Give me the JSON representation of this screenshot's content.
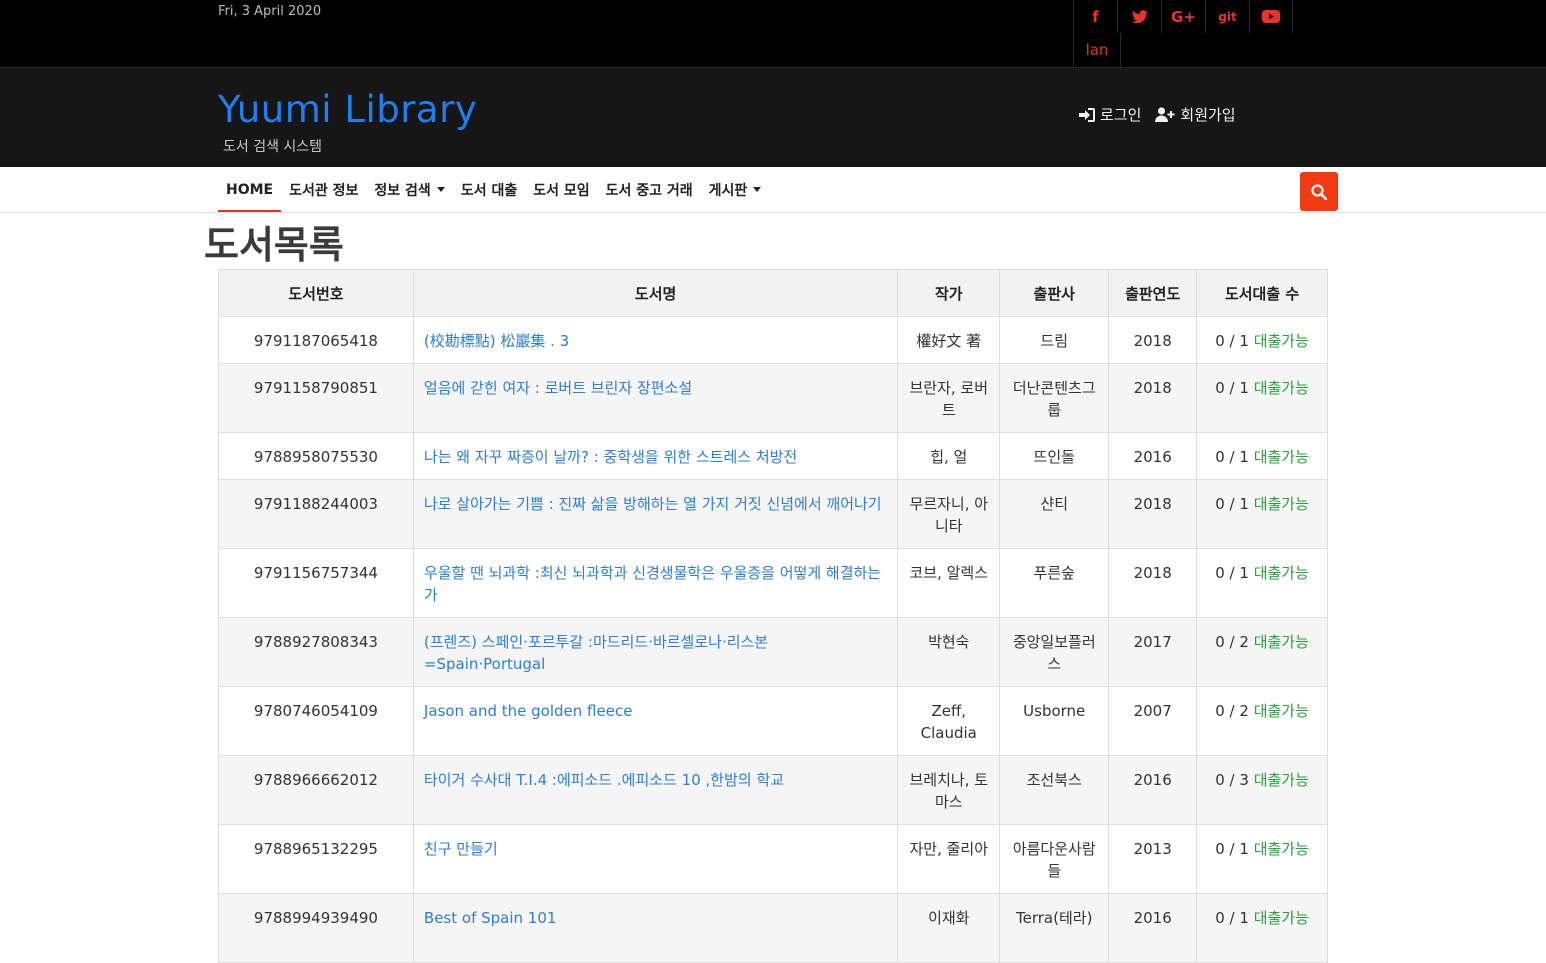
{
  "topbar": {
    "date": "Fri, 3 April 2020",
    "social": [
      {
        "icon": "facebook-icon",
        "glyph": "f"
      },
      {
        "icon": "twitter-icon",
        "glyph": "🐦"
      },
      {
        "icon": "google-plus-icon",
        "glyph": "G+"
      },
      {
        "icon": "git-icon",
        "glyph": "git"
      },
      {
        "icon": "youtube-icon",
        "glyph": "▶"
      }
    ],
    "lan": "lan"
  },
  "brand": {
    "title": "Yuumi Library",
    "subtitle": "도서 검색 시스템"
  },
  "auth": {
    "login": "로그인",
    "signup": "회원가입"
  },
  "nav": [
    {
      "label": "HOME",
      "dropdown": false
    },
    {
      "label": "도서관 정보",
      "dropdown": false
    },
    {
      "label": "정보 검색",
      "dropdown": true
    },
    {
      "label": "도서 대출",
      "dropdown": false
    },
    {
      "label": "도서 모임",
      "dropdown": false
    },
    {
      "label": "도서 중고 거래",
      "dropdown": false
    },
    {
      "label": "게시판",
      "dropdown": true
    }
  ],
  "page_title": "도서목록",
  "table": {
    "headers": [
      "도서번호",
      "도서명",
      "작가",
      "출판사",
      "출판연도",
      "도서대출 수"
    ],
    "rows": [
      {
        "isbn": "9791187065418",
        "title": "(校勘標點) 松巖集 . 3",
        "author": "權好文 著",
        "publisher": "드림",
        "year": "2018",
        "count": "0 / 1",
        "status": "대출가능"
      },
      {
        "isbn": "9791158790851",
        "title": "얼음에 갇힌 여자 : 로버트 브린자 장편소설",
        "author": "브란자, 로버트",
        "publisher": "더난콘텐츠그룹",
        "year": "2018",
        "count": "0 / 1",
        "status": "대출가능"
      },
      {
        "isbn": "9788958075530",
        "title": "나는 왜 자꾸 짜증이 날까? : 중학생을 위한 스트레스 처방전",
        "author": "힙, 얼",
        "publisher": "뜨인돌",
        "year": "2016",
        "count": "0 / 1",
        "status": "대출가능"
      },
      {
        "isbn": "9791188244003",
        "title": "나로 살아가는 기쁨 : 진짜 삶을 방해하는 열 가지 거짓 신념에서 깨어나기",
        "author": "무르자니, 아니타",
        "publisher": "샨티",
        "year": "2018",
        "count": "0 / 1",
        "status": "대출가능"
      },
      {
        "isbn": "9791156757344",
        "title": "우울할 땐 뇌과학 :최신 뇌과학과 신경생물학은 우울증을 어떻게 해결하는가",
        "author": "코브, 알렉스",
        "publisher": "푸른숲",
        "year": "2018",
        "count": "0 / 1",
        "status": "대출가능"
      },
      {
        "isbn": "9788927808343",
        "title": "(프렌즈) 스페인·포르투갈 :마드리드·바르셀로나·리스본 =Spain·Portugal",
        "author": "박현숙",
        "publisher": "중앙일보플러스",
        "year": "2017",
        "count": "0 / 2",
        "status": "대출가능"
      },
      {
        "isbn": "9780746054109",
        "title": "Jason and the golden fleece",
        "author": "Zeff, Claudia",
        "publisher": "Usborne",
        "year": "2007",
        "count": "0 / 2",
        "status": "대출가능"
      },
      {
        "isbn": "9788966662012",
        "title": "타이거 수사대 T.I.4 :에피소드 .에피소드 10 ,한밤의 학교",
        "author": "브레치나, 토마스",
        "publisher": "조선북스",
        "year": "2016",
        "count": "0 / 3",
        "status": "대출가능"
      },
      {
        "isbn": "9788965132295",
        "title": "친구 만들기",
        "author": "자만, 줄리아",
        "publisher": "아름다운사람들",
        "year": "2013",
        "count": "0 / 1",
        "status": "대출가능"
      },
      {
        "isbn": "9788994939490",
        "title": "Best of Spain 101",
        "author": "이재화",
        "publisher": "Terra(테라)",
        "year": "2016",
        "count": "0 / 1",
        "status": "대출가능"
      }
    ]
  },
  "colors": {
    "accent": "#e8322a",
    "brand": "#1e7ff0",
    "link": "#2b7fe0",
    "available": "#27a33a",
    "search_button": "#f23a13"
  }
}
